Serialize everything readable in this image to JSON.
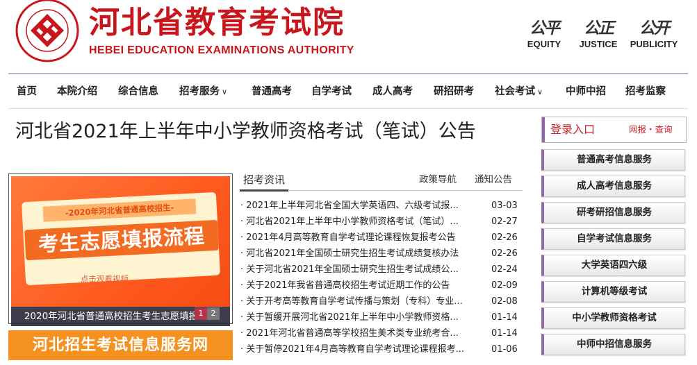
{
  "header": {
    "title_cn": "河北省教育考试院",
    "title_en": "HEBEI EDUCATION EXAMINATIONS AUTHORITY",
    "seal_text": "河北省教育考试院 HEBEI EDUCATION EXAMINATIONS AUTHORITY",
    "values": [
      {
        "cn": "公平",
        "en": "EQUITY"
      },
      {
        "cn": "公正",
        "en": "JUSTICE"
      },
      {
        "cn": "公开",
        "en": "PUBLICITY"
      }
    ]
  },
  "nav": {
    "items": [
      {
        "label": "首页",
        "dropdown": false
      },
      {
        "label": "本院介绍",
        "dropdown": false
      },
      {
        "label": "综合信息",
        "dropdown": false
      },
      {
        "label": "招考服务",
        "dropdown": true
      },
      {
        "label": "普通高考",
        "dropdown": false
      },
      {
        "label": "自学考试",
        "dropdown": false
      },
      {
        "label": "成人高考",
        "dropdown": false
      },
      {
        "label": "研招研考",
        "dropdown": false
      },
      {
        "label": "社会考试",
        "dropdown": true
      },
      {
        "label": "中师中招",
        "dropdown": false
      },
      {
        "label": "招考监察",
        "dropdown": false
      }
    ]
  },
  "headline": "河北省2021年上半年中小学教师资格考试（笔试）公告",
  "banner": {
    "tag": "-2020年河北省普通高校招生-",
    "main": "考生志愿填报流程",
    "sub": "点击观看视频",
    "caption": "2020年河北省普通高校招生考生志愿填报流程",
    "pages": [
      "1",
      "2"
    ],
    "service": "河北招生考试信息服务网"
  },
  "news": {
    "tabs": [
      "招考资讯",
      "政策导航",
      "通知公告"
    ],
    "items": [
      {
        "title": "· 2021年上半年河北省全国大学英语四、六级考试报...",
        "date": "03-03"
      },
      {
        "title": "· 河北省2021年上半年中小学教师资格考试（笔试）...",
        "date": "02-27"
      },
      {
        "title": "· 2021年4月高等教育自学考试理论课程恢复报考公告",
        "date": "02-26"
      },
      {
        "title": "· 河北省2021年全国硕士研究生招生考试成绩复核办法",
        "date": "02-26"
      },
      {
        "title": "· 关于河北省2021年全国硕士研究生招生考试成绩公...",
        "date": "02-24"
      },
      {
        "title": "· 关于2021年我省普通高校招生考试近期工作的公告",
        "date": "02-09"
      },
      {
        "title": "· 关于开考高等教育自学考试传播与策划（专科）专业...",
        "date": "02-08"
      },
      {
        "title": "· 关于暂缓开展河北省2021年上半年中小学教师资格...",
        "date": "01-14"
      },
      {
        "title": "· 2021年河北省普通高等学校招生美术类专业统考合...",
        "date": "01-14"
      },
      {
        "title": "· 关于暂停2021年4月高等教育自学考试理论课程报考...",
        "date": "01-06"
      }
    ]
  },
  "sidebar": {
    "login_title": "登录入口",
    "login_links": "网报・查询",
    "services": [
      "普通高考信息服务",
      "成人高考信息服务",
      "研考研招信息服务",
      "自学考试信息服务",
      "大学英语四六级",
      "计算机等级考试",
      "中小学教师资格考试",
      "中师中招信息服务"
    ]
  },
  "colors": {
    "brand_red": "#c8161d",
    "accent_purple": "#8d6aa6",
    "banner_orange": "#f5911e"
  }
}
